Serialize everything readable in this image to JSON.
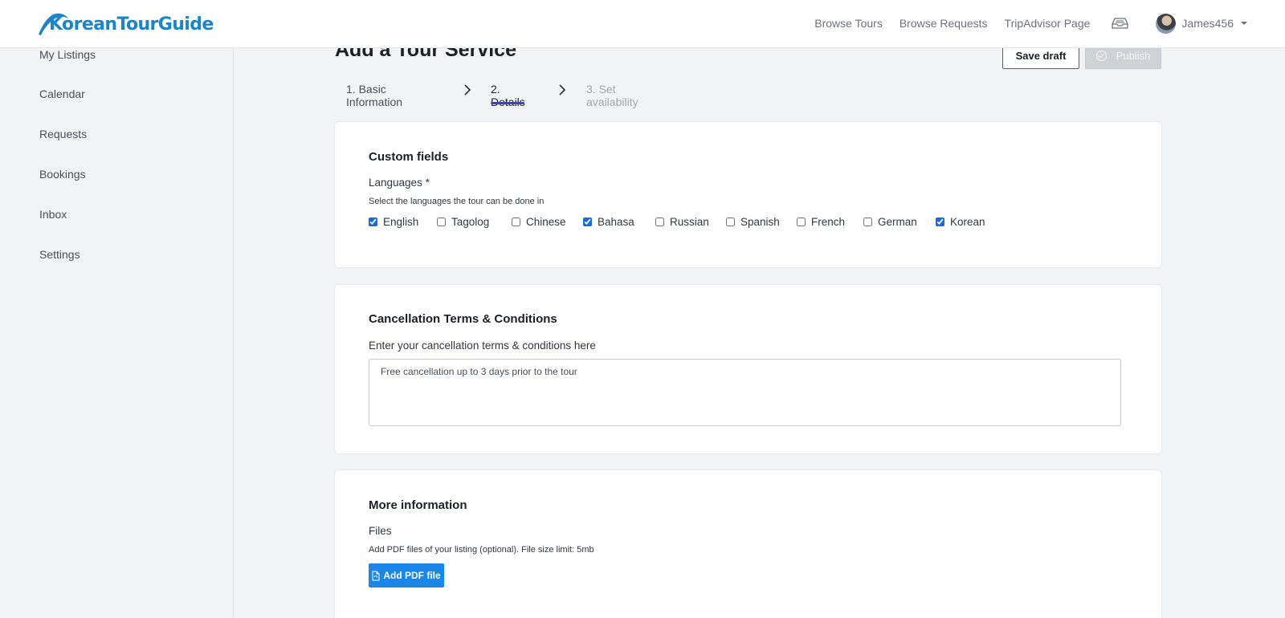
{
  "app": {
    "logo_text": "KoreanTourGuide"
  },
  "topnav": {
    "links": [
      "Browse Tours",
      "Browse Requests",
      "TripAdvisor Page"
    ],
    "inbox_icon": "inbox-tray-icon",
    "username": "James456"
  },
  "sidebar": {
    "items": [
      {
        "label": "My Listings"
      },
      {
        "label": "Calendar"
      },
      {
        "label": "Requests"
      },
      {
        "label": "Bookings"
      },
      {
        "label": "Inbox"
      },
      {
        "label": "Settings"
      }
    ]
  },
  "page": {
    "title": "Add a Tour Service",
    "save_draft_label": "Save draft",
    "publish_label": "Publish",
    "publish_enabled": false
  },
  "stepper": {
    "steps": [
      {
        "label": "1. Basic Information",
        "state": "done"
      },
      {
        "label": "2. Details",
        "state": "active"
      },
      {
        "label": "3. Set availability",
        "state": "disabled"
      }
    ]
  },
  "custom_fields": {
    "title": "Custom fields",
    "languages_label": "Languages *",
    "languages_hint": "Select the languages the tour can be done in",
    "languages": [
      {
        "label": "English",
        "checked": true
      },
      {
        "label": "Tagolog",
        "checked": false
      },
      {
        "label": "Chinese",
        "checked": false
      },
      {
        "label": "Bahasa",
        "checked": true
      },
      {
        "label": "Russian",
        "checked": false
      },
      {
        "label": "Spanish",
        "checked": false
      },
      {
        "label": "French",
        "checked": false
      },
      {
        "label": "German",
        "checked": false
      },
      {
        "label": "Korean",
        "checked": true
      }
    ]
  },
  "cancellation": {
    "title": "Cancellation Terms & Conditions",
    "label": "Enter your cancellation terms & conditions here",
    "value": "Free cancellation up to 3 days prior to the tour"
  },
  "more_info": {
    "title": "More information",
    "files_label": "Files",
    "files_hint": "Add PDF files of your listing (optional). File size limit: 5mb",
    "add_pdf_label": "Add PDF file"
  },
  "colors": {
    "brand": "#1a86c9",
    "step_active_underline": "#3d3fd9",
    "primary_button": "#1a86e8",
    "checkbox": "#1a6bd9"
  }
}
